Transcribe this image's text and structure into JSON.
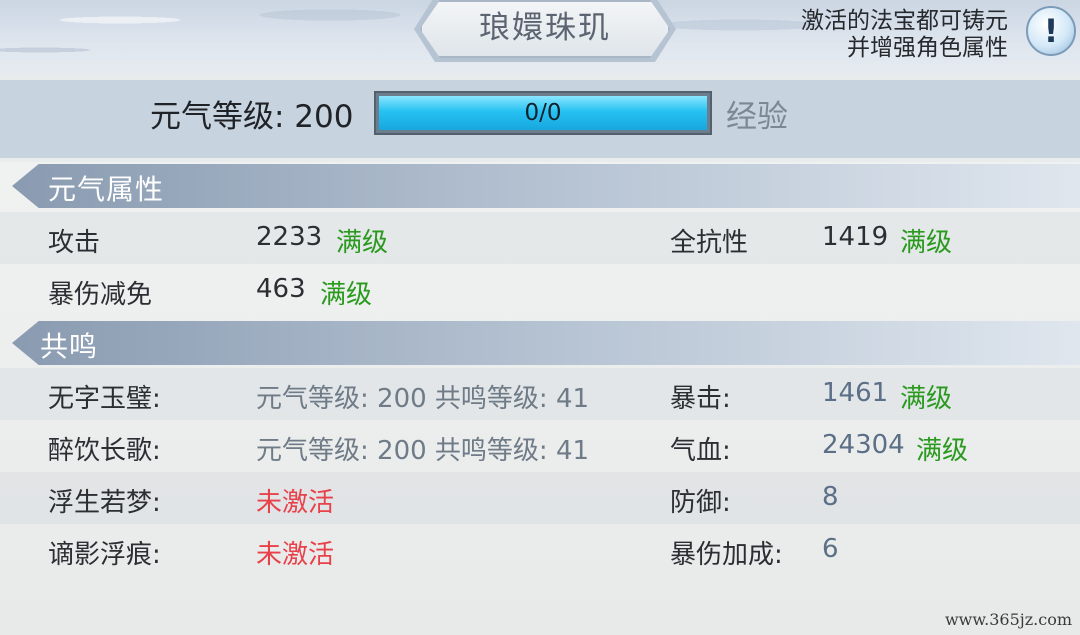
{
  "header": {
    "title": "琅嬛珠玑",
    "hint_line1": "激活的法宝都可铸元",
    "hint_line2": "并增强角色属性",
    "info_icon": "!"
  },
  "level": {
    "label": "元气等级: 200",
    "progress_text": "0/0",
    "exp_label": "经验"
  },
  "attributes": {
    "title": "元气属性",
    "items": [
      {
        "name": "攻击",
        "value": "2233",
        "status": "满级"
      },
      {
        "name": "全抗性",
        "value": "1419",
        "status": "满级"
      },
      {
        "name": "暴伤减免",
        "value": "463",
        "status": "满级"
      }
    ]
  },
  "resonance": {
    "title": "共鸣",
    "sets": [
      {
        "name": "无字玉璧:",
        "condition": "元气等级: 200 共鸣等级: 41"
      },
      {
        "name": "醉饮长歌:",
        "condition": "元气等级: 200 共鸣等级: 41"
      },
      {
        "name": "浮生若梦:",
        "condition": "未激活"
      },
      {
        "name": "谪影浮痕:",
        "condition": "未激活"
      }
    ],
    "bonuses": [
      {
        "name": "暴击:",
        "value": "1461",
        "status": "满级"
      },
      {
        "name": "气血:",
        "value": "24304",
        "status": "满级"
      },
      {
        "name": "防御:",
        "value": "8"
      },
      {
        "name": "暴伤加成:",
        "value": "6"
      }
    ]
  },
  "watermark": "www.365jz.com",
  "colors": {
    "max_level_green": "#2a9a1e",
    "inactive_red": "#e8414a",
    "progress_cyan": "#26c2f2"
  }
}
